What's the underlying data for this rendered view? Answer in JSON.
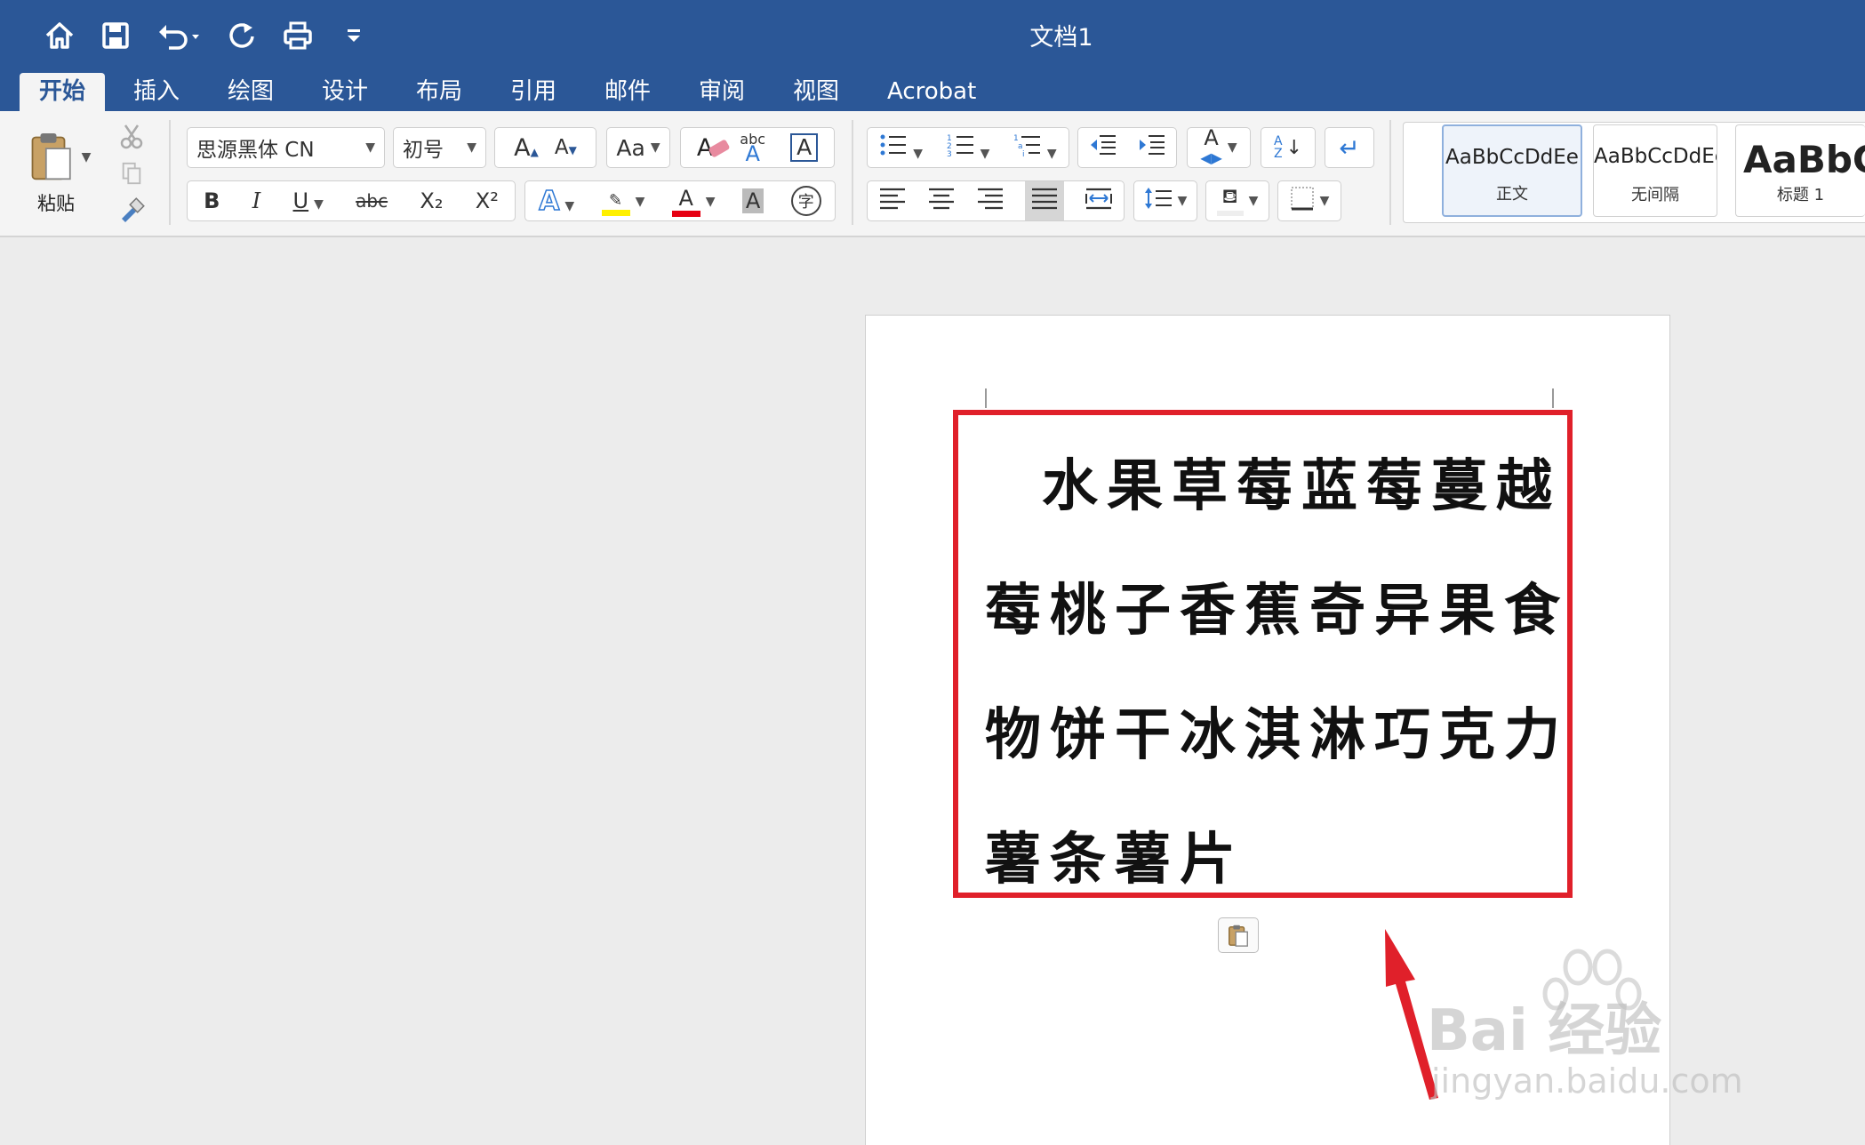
{
  "window": {
    "title": "文档1"
  },
  "quick_access": {
    "icons": [
      "home-icon",
      "save-icon",
      "undo-icon",
      "redo-icon",
      "print-icon",
      "customize-icon"
    ]
  },
  "tabs": [
    {
      "label": "开始",
      "active": true
    },
    {
      "label": "插入"
    },
    {
      "label": "绘图"
    },
    {
      "label": "设计"
    },
    {
      "label": "布局"
    },
    {
      "label": "引用"
    },
    {
      "label": "邮件"
    },
    {
      "label": "审阅"
    },
    {
      "label": "视图"
    },
    {
      "label": "Acrobat"
    }
  ],
  "clipboard": {
    "paste_label": "粘贴"
  },
  "font": {
    "family": "思源黑体 CN",
    "size": "初号",
    "bold_label": "B",
    "italic_label": "I",
    "underline_label": "U",
    "strike_label": "abc",
    "sub_label": "X₂",
    "sup_label": "X²",
    "font_color": "#e60012",
    "highlight_color": "#fff000"
  },
  "styles": [
    {
      "sample": "AaBbCcDdEe",
      "name": "正文",
      "selected": true
    },
    {
      "sample": "AaBbCcDdEe",
      "name": "无间隔"
    },
    {
      "sample": "AaBbC",
      "name": "标题 1"
    }
  ],
  "document": {
    "lines": [
      "水果草莓蓝莓蔓越",
      "莓桃子香蕉奇异果食",
      "物饼干冰淇淋巧克力",
      "薯条薯片"
    ]
  },
  "annotation": {
    "box_color": "#e0202a",
    "arrow_color": "#e0202a"
  },
  "watermark": {
    "brand": "Bai 经验",
    "url": "jingyan.baidu.com"
  }
}
